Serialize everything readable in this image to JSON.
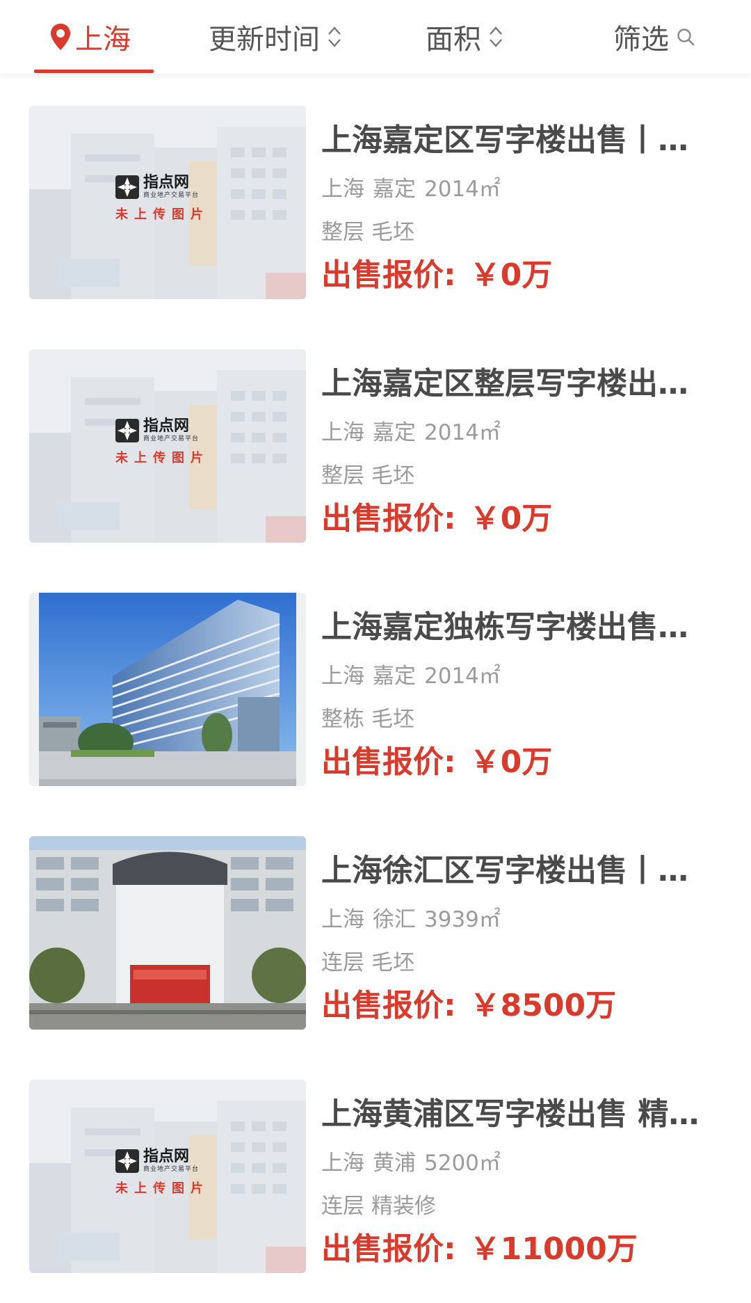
{
  "filter_bar": {
    "city": "上海",
    "update_time": "更新时间",
    "area": "面积",
    "filter": "筛选"
  },
  "colors": {
    "accent": "#d93a2b",
    "title": "#4a4a4a",
    "meta": "#9b9b9b"
  },
  "placeholder": {
    "brand": "指点网",
    "tagline": "商业地产交易平台",
    "note": "未上传图片"
  },
  "listings": [
    {
      "title": "上海嘉定区写字楼出售丨…",
      "city": "上海",
      "district": "嘉定",
      "area": "2014㎡",
      "floor": "整层",
      "decoration": "毛坯",
      "price_label": "出售报价:",
      "price": "￥0万",
      "image": "placeholder"
    },
    {
      "title": "上海嘉定区整层写字楼出…",
      "city": "上海",
      "district": "嘉定",
      "area": "2014㎡",
      "floor": "整层",
      "decoration": "毛坯",
      "price_label": "出售报价:",
      "price": "￥0万",
      "image": "placeholder"
    },
    {
      "title": "上海嘉定独栋写字楼出售…",
      "city": "上海",
      "district": "嘉定",
      "area": "2014㎡",
      "floor": "整栋",
      "decoration": "毛坯",
      "price_label": "出售报价:",
      "price": "￥0万",
      "image": "office-tower-photo"
    },
    {
      "title": "上海徐汇区写字楼出售丨…",
      "city": "上海",
      "district": "徐汇",
      "area": "3939㎡",
      "floor": "连层",
      "decoration": "毛坯",
      "price_label": "出售报价:",
      "price": "￥8500万",
      "image": "building-facade-photo"
    },
    {
      "title": "上海黄浦区写字楼出售 精…",
      "city": "上海",
      "district": "黄浦",
      "area": "5200㎡",
      "floor": "连层",
      "decoration": "精装修",
      "price_label": "出售报价:",
      "price": "￥11000万",
      "image": "placeholder"
    }
  ]
}
